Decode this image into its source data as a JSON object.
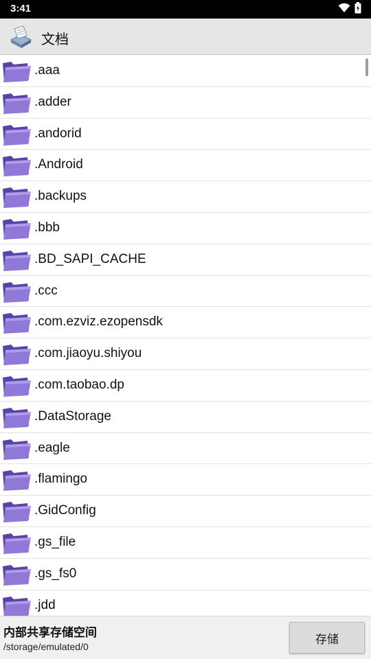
{
  "status_bar": {
    "time": "3:41",
    "icons": [
      "wifi-icon",
      "battery-icon"
    ]
  },
  "app_bar": {
    "icon": "document-printer-icon",
    "title": "文档"
  },
  "file_list": {
    "icon": "folder-icon",
    "items": [
      ".aaa",
      ".adder",
      ".andorid",
      ".Android",
      ".backups",
      ".bbb",
      ".BD_SAPI_CACHE",
      ".ccc",
      ".com.ezviz.ezopensdk",
      ".com.jiaoyu.shiyou",
      ".com.taobao.dp",
      ".DataStorage",
      ".eagle",
      ".flamingo",
      ".GidConfig",
      ".gs_file",
      ".gs_fs0",
      ".jdd"
    ]
  },
  "bottom_bar": {
    "storage_title": "内部共享存储空间",
    "storage_path": "/storage/emulated/0",
    "save_label": "存储"
  },
  "colors": {
    "folder": "#8f78d8",
    "folder_dark": "#5a43a8",
    "app_bar": "#e6e6e6"
  }
}
